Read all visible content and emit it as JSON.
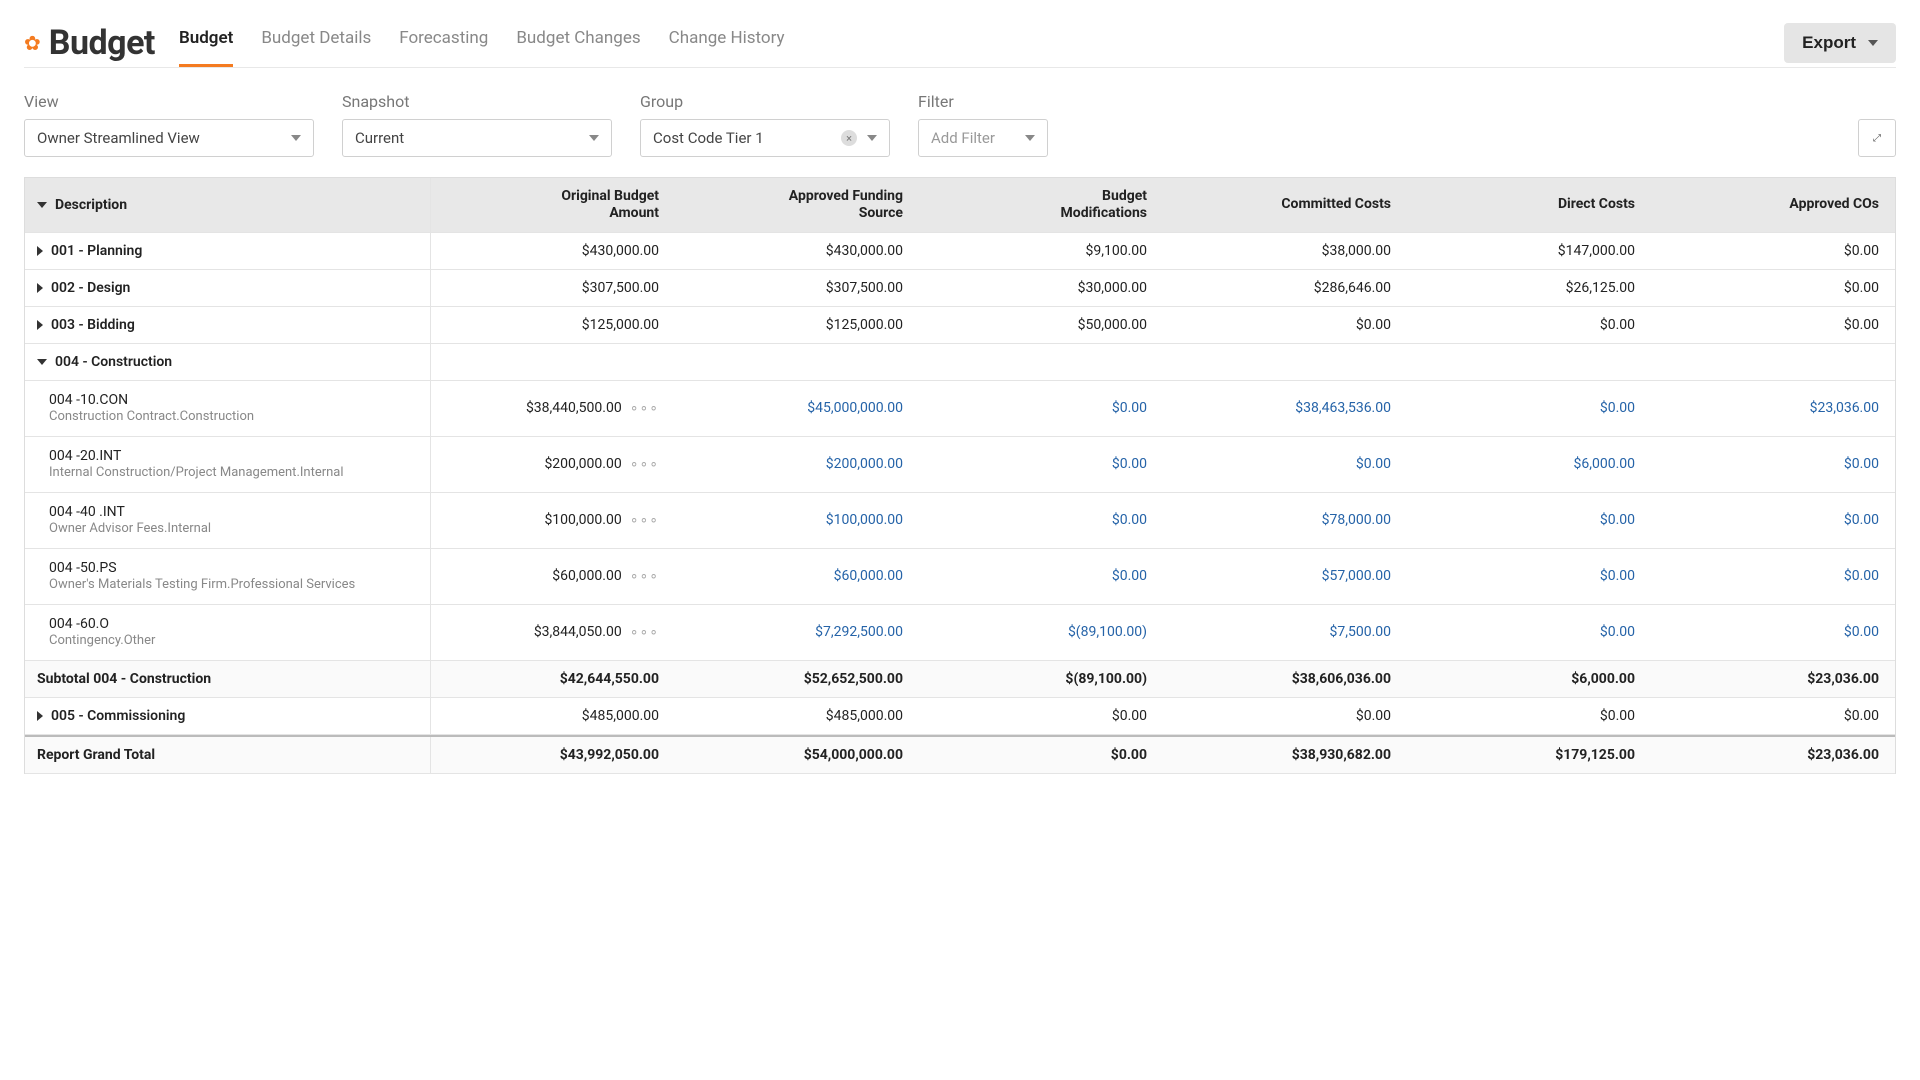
{
  "header": {
    "title": "Budget",
    "tabs": [
      "Budget",
      "Budget Details",
      "Forecasting",
      "Budget Changes",
      "Change History"
    ],
    "active_tab": 0,
    "export_label": "Export"
  },
  "controls": {
    "view": {
      "label": "View",
      "value": "Owner Streamlined View"
    },
    "snapshot": {
      "label": "Snapshot",
      "value": "Current"
    },
    "group": {
      "label": "Group",
      "value": "Cost Code Tier 1"
    },
    "filter": {
      "label": "Filter",
      "value": "Add Filter"
    }
  },
  "columns": [
    "Description",
    "Original Budget\nAmount",
    "Approved Funding\nSource",
    "Budget\nModifications",
    "Committed Costs",
    "Direct Costs",
    "Approved COs"
  ],
  "groups": [
    {
      "expanded": false,
      "code": "001 - Planning",
      "totals": [
        "$430,000.00",
        "$430,000.00",
        "$9,100.00",
        "$38,000.00",
        "$147,000.00",
        "$0.00"
      ]
    },
    {
      "expanded": false,
      "code": "002 - Design",
      "totals": [
        "$307,500.00",
        "$307,500.00",
        "$30,000.00",
        "$286,646.00",
        "$26,125.00",
        "$0.00"
      ]
    },
    {
      "expanded": false,
      "code": "003 - Bidding",
      "totals": [
        "$125,000.00",
        "$125,000.00",
        "$50,000.00",
        "$0.00",
        "$0.00",
        "$0.00"
      ]
    },
    {
      "expanded": true,
      "code": "004 - Construction",
      "rows": [
        {
          "code": "004 -10.CON",
          "sub": "Construction Contract.Construction",
          "vals": [
            "$38,440,500.00",
            "$45,000,000.00",
            "$0.00",
            "$38,463,536.00",
            "$0.00",
            "$23,036.00"
          ]
        },
        {
          "code": "004 -20.INT",
          "sub": "Internal Construction/Project Management.Internal",
          "vals": [
            "$200,000.00",
            "$200,000.00",
            "$0.00",
            "$0.00",
            "$6,000.00",
            "$0.00"
          ]
        },
        {
          "code": "004 -40 .INT",
          "sub": "Owner Advisor Fees.Internal",
          "vals": [
            "$100,000.00",
            "$100,000.00",
            "$0.00",
            "$78,000.00",
            "$0.00",
            "$0.00"
          ]
        },
        {
          "code": "004 -50.PS",
          "sub": "Owner's Materials Testing Firm.Professional Services",
          "vals": [
            "$60,000.00",
            "$60,000.00",
            "$0.00",
            "$57,000.00",
            "$0.00",
            "$0.00"
          ]
        },
        {
          "code": "004 -60.O",
          "sub": "Contingency.Other",
          "vals": [
            "$3,844,050.00",
            "$7,292,500.00",
            "$(89,100.00)",
            "$7,500.00",
            "$0.00",
            "$0.00"
          ]
        }
      ],
      "subtotal_label": "Subtotal 004 - Construction",
      "subtotal": [
        "$42,644,550.00",
        "$52,652,500.00",
        "$(89,100.00)",
        "$38,606,036.00",
        "$6,000.00",
        "$23,036.00"
      ]
    },
    {
      "expanded": false,
      "code": "005 - Commissioning",
      "totals": [
        "$485,000.00",
        "$485,000.00",
        "$0.00",
        "$0.00",
        "$0.00",
        "$0.00"
      ]
    }
  ],
  "grand_label": "Report Grand Total",
  "grand": [
    "$43,992,050.00",
    "$54,000,000.00",
    "$0.00",
    "$38,930,682.00",
    "$179,125.00",
    "$23,036.00"
  ]
}
